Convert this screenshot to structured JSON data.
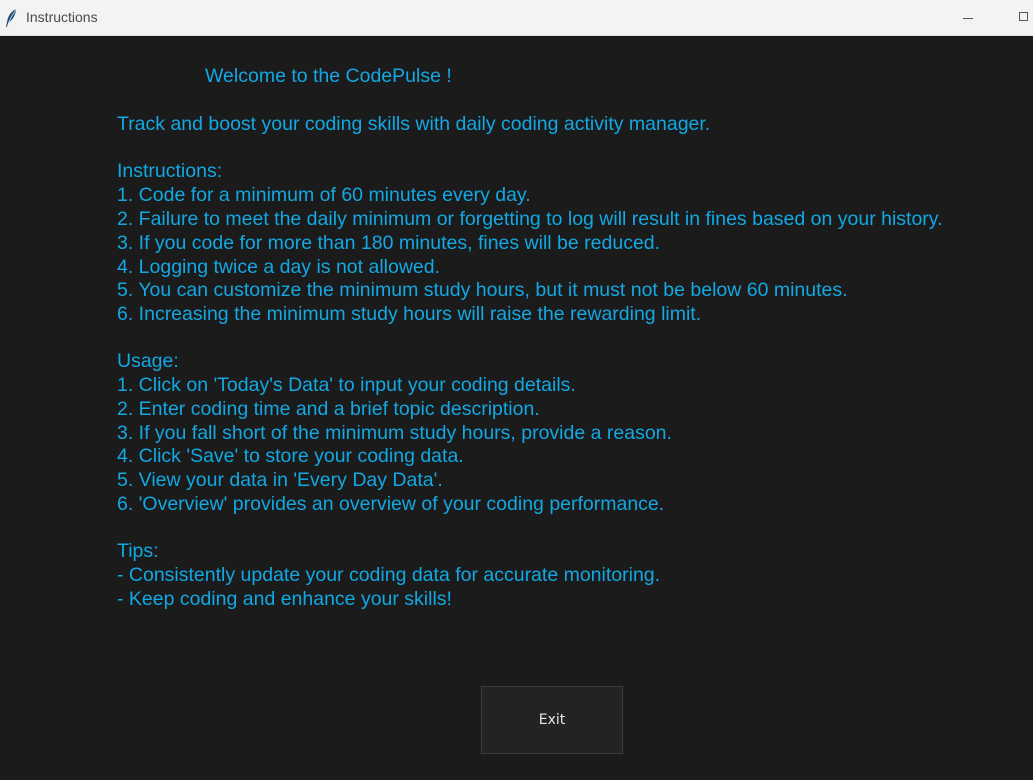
{
  "window": {
    "title": "Instructions",
    "app_icon": "feather-icon",
    "controls": {
      "minimize_icon": "minimize-icon",
      "maximize_icon": "maximize-icon"
    }
  },
  "colors": {
    "background": "#1b1b1b",
    "text": "#12a8e3",
    "titlebar": "#f3f3f3",
    "button_bg": "#232323",
    "button_text": "#e8e8e8"
  },
  "content": {
    "welcome": "Welcome to the CodePulse !",
    "tagline": "Track and boost your coding skills with daily coding activity manager.",
    "instructions": {
      "heading": "Instructions:",
      "items": [
        "1. Code for a minimum of 60 minutes every day.",
        "2. Failure to meet the daily minimum or forgetting to log will result in fines based on your history.",
        "3. If you code for more than 180 minutes, fines will be reduced.",
        "4. Logging twice a day is not allowed.",
        "5. You can customize the minimum study hours, but it must not be below 60 minutes.",
        "6. Increasing the minimum study hours will raise the rewarding limit."
      ]
    },
    "usage": {
      "heading": "Usage:",
      "items": [
        "1. Click on 'Today's Data' to input your coding details.",
        "2. Enter coding time and a brief topic description.",
        "3. If you fall short of the minimum study hours, provide a reason.",
        "4. Click 'Save' to store your coding data.",
        "5. View your data in 'Every Day Data'.",
        "6. 'Overview' provides an overview of your coding performance."
      ]
    },
    "tips": {
      "heading": "Tips:",
      "items": [
        "- Consistently update your coding data for accurate monitoring.",
        "- Keep coding and enhance your skills!"
      ]
    }
  },
  "buttons": {
    "exit_label": "Exit"
  }
}
